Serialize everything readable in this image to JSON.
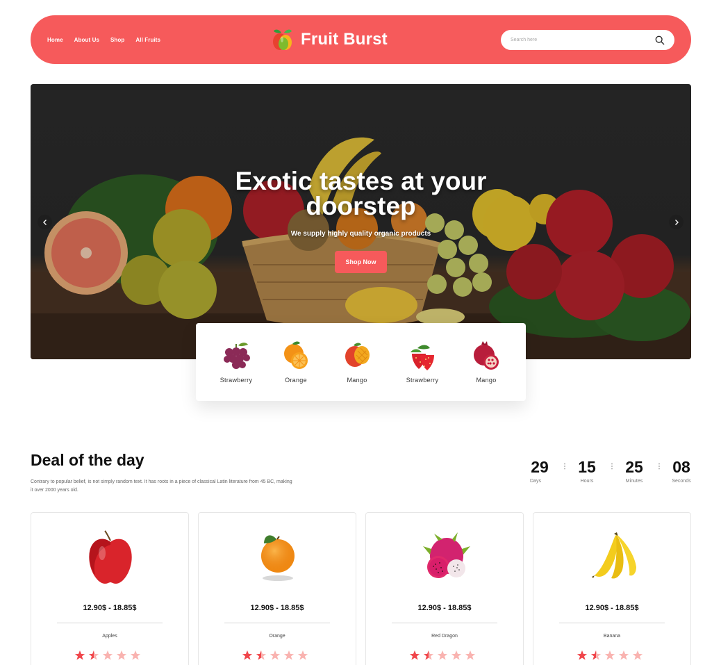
{
  "header": {
    "nav": [
      "Home",
      "About Us",
      "Shop",
      "All Fruits"
    ],
    "brand": "Fruit Burst",
    "search_placeholder": "Search here"
  },
  "hero": {
    "title_line1": "Exotic tastes at your",
    "title_line2": "doorstep",
    "subtitle": "We supply highly quality organic products",
    "button": "Shop Now"
  },
  "categories": [
    "Strawberry",
    "Orange",
    "Mango",
    "Strawberry",
    "Mango"
  ],
  "deal": {
    "title": "Deal of the day",
    "description": "Contrary to popular belief, is not simply random text. It has roots in a piece of classical Latin literature from 45 BC, making it over 2000 years old."
  },
  "countdown": {
    "days": "29",
    "days_label": "Days",
    "hours": "15",
    "hours_label": "Hours",
    "minutes": "25",
    "minutes_label": "Minutes",
    "seconds": "08",
    "seconds_label": "Seconds"
  },
  "products": [
    {
      "name": "Apples",
      "price": "12.90$ - 18.85$",
      "rating": 1.5
    },
    {
      "name": "Orange",
      "price": "12.90$ - 18.85$",
      "rating": 1.5
    },
    {
      "name": "Red Dragon",
      "price": "12.90$ - 18.85$",
      "rating": 1.5
    },
    {
      "name": "Banana",
      "price": "12.90$ - 18.85$",
      "rating": 1.5
    }
  ],
  "colors": {
    "accent": "#f65a5b",
    "star_filled": "#f0464b",
    "star_empty": "#f9b3b0"
  }
}
